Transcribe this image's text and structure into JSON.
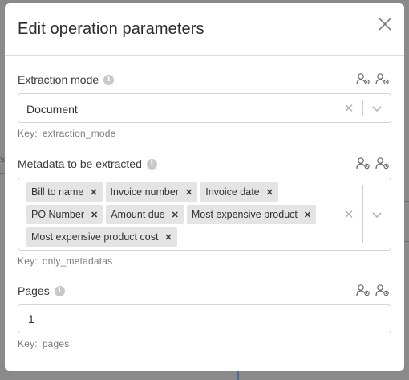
{
  "backdrop": {
    "left_hint": "s"
  },
  "modal": {
    "title": "Edit operation parameters"
  },
  "fields": {
    "extraction_mode": {
      "label": "Extraction mode",
      "value": "Document",
      "key_prefix": "Key:",
      "key_name": "extraction_mode"
    },
    "metadata": {
      "label": "Metadata to be extracted",
      "tags": [
        "Bill to name",
        "Invoice number",
        "Invoice date",
        "PO Number",
        "Amount due",
        "Most expensive product",
        "Most expensive product cost"
      ],
      "key_prefix": "Key:",
      "key_name": "only_metadatas"
    },
    "pages": {
      "label": "Pages",
      "value": "1",
      "key_prefix": "Key:",
      "key_name": "pages"
    }
  },
  "icons": {
    "info": "info-icon",
    "user_settings": "user-gear-icon",
    "close": "close-icon",
    "clear": "clear-icon",
    "chevron": "chevron-down-icon",
    "tag_remove": "tag-remove-icon"
  },
  "colors": {
    "accent": "#2c2c2c",
    "tag_bg": "#e4e4e4",
    "border": "#d6d6d6"
  },
  "glyphs": {
    "info": "i",
    "clear": "✕",
    "tag_remove": "✕"
  }
}
